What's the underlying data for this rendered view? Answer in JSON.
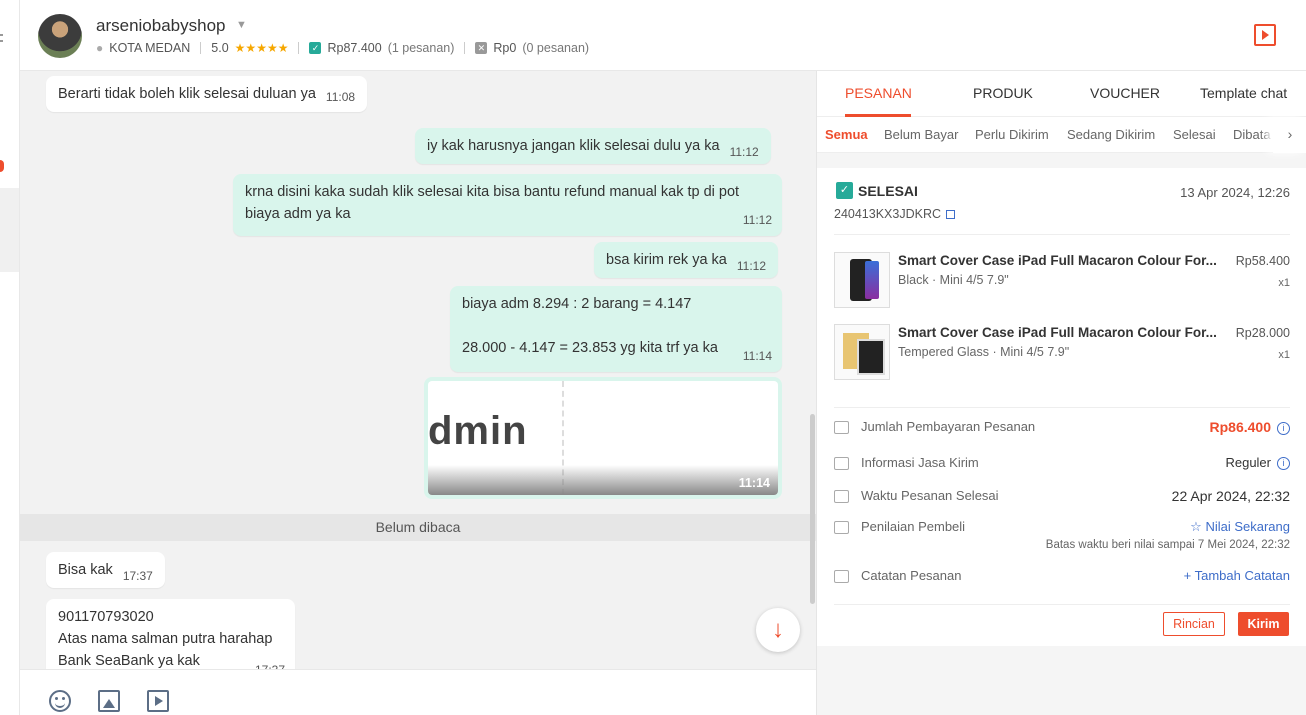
{
  "header": {
    "shop_name": "arseniobabyshop",
    "location": "KOTA MEDAN",
    "rating": "5.0",
    "stars": "★★★★★",
    "paid_amount": "Rp87.400",
    "paid_orders": "(1 pesanan)",
    "unpaid_amount": "Rp0",
    "unpaid_orders": "(0 pesanan)"
  },
  "messages": [
    {
      "dir": "in",
      "text": "Berarti tidak boleh klik selesai duluan ya",
      "time": "11:08"
    },
    {
      "dir": "out",
      "text": "iy kak harusnya jangan klik selesai dulu ya ka",
      "time": "11:12"
    },
    {
      "dir": "out",
      "line1": "krna disini kaka sudah klik selesai kita bisa bantu refund manual kak tp di pot",
      "line2": "biaya adm ya ka",
      "time": "11:12"
    },
    {
      "dir": "out",
      "text": "bsa kirim rek ya ka",
      "time": "11:12"
    },
    {
      "dir": "out",
      "line1": "biaya adm 8.294 : 2 barang = 4.147",
      "line2": "28.000 - 4.147 = 23.853 yg kita trf ya ka",
      "time": "11:14"
    },
    {
      "dir": "out",
      "image_text": "dmin",
      "time": "11:14"
    },
    {
      "dir": "in",
      "text": "Bisa kak",
      "time": "17:37"
    },
    {
      "dir": "in",
      "line1": "901170793020",
      "line2": "Atas nama salman putra harahap",
      "line3": "Bank SeaBank ya kak",
      "time": "17:37"
    }
  ],
  "unread_label": "Belum dibaca",
  "right_panel": {
    "tabs": [
      "PESANAN",
      "PRODUK",
      "VOUCHER",
      "Template chat"
    ],
    "subtabs": [
      "Semua",
      "Belum Bayar",
      "Perlu Dikirim",
      "Sedang Dikirim",
      "Selesai",
      "Dibata"
    ],
    "order": {
      "status": "SELESAI",
      "date": "13 Apr 2024, 12:26",
      "id": "240413KX3JDKRC",
      "products": [
        {
          "name": "Smart Cover Case iPad Full Macaron Colour For...",
          "variant": "Black · Mini 4/5 7.9\"",
          "price": "Rp58.400",
          "qty": "x1"
        },
        {
          "name": "Smart Cover Case iPad Full Macaron Colour For...",
          "variant": "Tempered Glass · Mini 4/5 7.9\"",
          "price": "Rp28.000",
          "qty": "x1"
        }
      ],
      "total_label": "Jumlah Pembayaran Pesanan",
      "total_value": "Rp86.400",
      "shipping_label": "Informasi Jasa Kirim",
      "shipping_value": "Reguler",
      "completed_label": "Waktu Pesanan Selesai",
      "completed_value": "22 Apr 2024, 22:32",
      "review_label": "Penilaian Pembeli",
      "review_value": "Nilai Sekarang",
      "review_deadline": "Batas waktu beri nilai sampai 7 Mei 2024, 22:32",
      "note_label": "Catatan Pesanan",
      "note_value": "Tambah Catatan",
      "detail_button": "Rincian",
      "send_button": "Kirim"
    }
  },
  "colors": {
    "accent": "#ee4d2d",
    "out_bubble": "#d9f5ec",
    "success": "#26aa99",
    "link": "#3e6dc9",
    "star": "#f6a700"
  }
}
